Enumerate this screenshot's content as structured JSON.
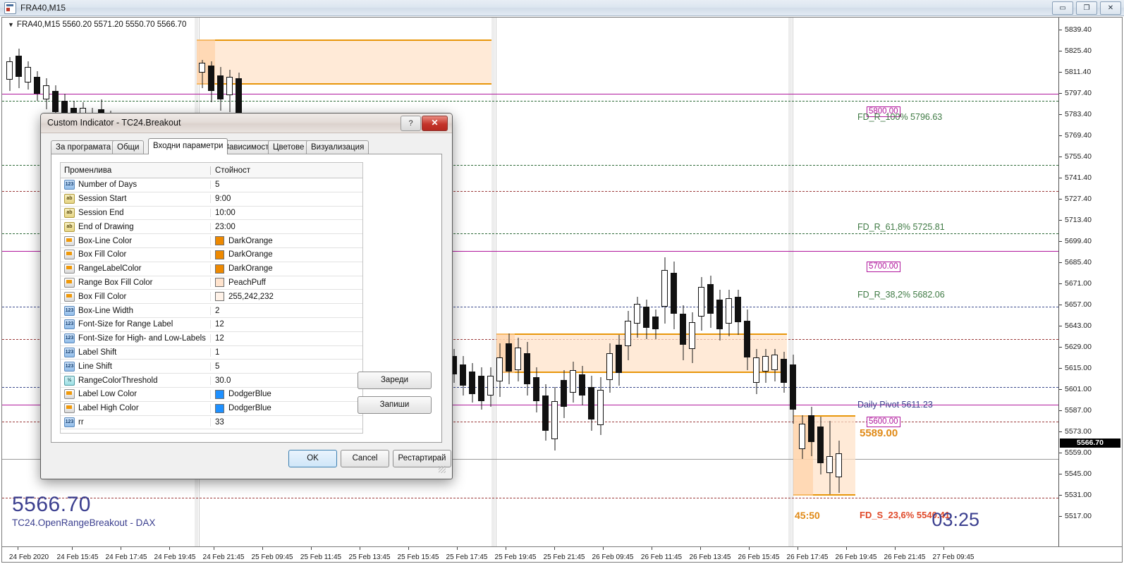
{
  "window": {
    "title": "FRA40,M15",
    "icon": "chart-window-icon",
    "buttons": {
      "minimize": "▭",
      "restore": "❐",
      "close": "✕"
    }
  },
  "chart": {
    "symbol_line": "FRA40,M15  5560.20 5571.20 5550.70 5566.70",
    "big_price": "5566.70",
    "sub_title": "TC24.OpenRangeBreakout - DAX",
    "clock": "03:25",
    "session_label": "45:50",
    "price_axis": {
      "ticks": [
        "5839.40",
        "5825.40",
        "5811.40",
        "5797.40",
        "5783.40",
        "5769.40",
        "5755.40",
        "5741.40",
        "5727.40",
        "5713.40",
        "5699.40",
        "5685.40",
        "5671.00",
        "5657.00",
        "5643.00",
        "5629.00",
        "5615.00",
        "5601.00",
        "5587.00",
        "5573.00",
        "5559.00",
        "5545.00",
        "5531.00",
        "5517.00"
      ],
      "last_price": "5566.70"
    },
    "time_axis": {
      "ticks": [
        "24 Feb 2020",
        "24 Feb 15:45",
        "24 Feb 17:45",
        "24 Feb 19:45",
        "24 Feb 21:45",
        "25 Feb 09:45",
        "25 Feb 11:45",
        "25 Feb 13:45",
        "25 Feb 15:45",
        "25 Feb 17:45",
        "25 Feb 19:45",
        "25 Feb 21:45",
        "26 Feb 09:45",
        "26 Feb 11:45",
        "26 Feb 13:45",
        "26 Feb 15:45",
        "26 Feb 17:45",
        "26 Feb 19:45",
        "26 Feb 21:45",
        "27 Feb 09:45"
      ]
    },
    "annotations": [
      {
        "text": "5800.00",
        "type": "tag"
      },
      {
        "text": "FD_R_100% 5796.63",
        "type": "green"
      },
      {
        "text": "FD_R_61,8% 5725.81",
        "type": "green"
      },
      {
        "text": "5700.00",
        "type": "tag"
      },
      {
        "text": "FD_R_38,2% 5682.06",
        "type": "green"
      },
      {
        "text": "Daily Pivot 5611.23",
        "type": "blue"
      },
      {
        "text": "5600.00",
        "type": "tag"
      },
      {
        "text": "5589.00",
        "type": "orange"
      },
      {
        "text": "FD_S_23,6% 5540.41",
        "type": "red"
      }
    ],
    "colors": {
      "pivot_line": "#b0179c",
      "fib_line": "#2f6b3a",
      "box_line": "#e8960a",
      "box_fill": "#ffe2c7",
      "label_blue": "#3b3f8f"
    }
  },
  "dialog": {
    "title": "Custom Indicator - TC24.Breakout",
    "help_label": "?",
    "close_label": "✕",
    "tabs": [
      {
        "label": "За програмата",
        "active": false
      },
      {
        "label": "Общи",
        "active": false
      },
      {
        "label": "Входни параметри",
        "active": true
      },
      {
        "label": "Зависимости",
        "active": false
      },
      {
        "label": "Цветове",
        "active": false
      },
      {
        "label": "Визуализация",
        "active": false
      }
    ],
    "grid": {
      "header": {
        "variable": "Променлива",
        "value": "Стойност"
      },
      "rows": [
        {
          "icon": "num",
          "name": "Number of Days",
          "value": "5"
        },
        {
          "icon": "str",
          "name": "Session Start",
          "value": "9:00"
        },
        {
          "icon": "str",
          "name": "Session End",
          "value": "10:00"
        },
        {
          "icon": "str",
          "name": "End of Drawing",
          "value": "23:00"
        },
        {
          "icon": "col",
          "name": "Box-Line Color",
          "value": "DarkOrange",
          "swatch": "#ee8900"
        },
        {
          "icon": "col",
          "name": "Box Fill Color",
          "value": "DarkOrange",
          "swatch": "#ee8900"
        },
        {
          "icon": "col",
          "name": "RangeLabelColor",
          "value": "DarkOrange",
          "swatch": "#ee8900"
        },
        {
          "icon": "col",
          "name": "Range Box Fill Color",
          "value": "PeachPuff",
          "swatch": "#ffe3cd"
        },
        {
          "icon": "col",
          "name": "Box Fill Color",
          "value": "255,242,232",
          "swatch": "#fff2e8"
        },
        {
          "icon": "num",
          "name": "Box-Line Width",
          "value": "2"
        },
        {
          "icon": "num",
          "name": "Font-Size for Range Label",
          "value": "12"
        },
        {
          "icon": "num",
          "name": "Font-Size for High- and Low-Labels",
          "value": "12"
        },
        {
          "icon": "num",
          "name": "Label Shift",
          "value": "1"
        },
        {
          "icon": "num",
          "name": "Line Shift",
          "value": "5"
        },
        {
          "icon": "dbl",
          "name": "RangeColorThreshold",
          "value": "30.0"
        },
        {
          "icon": "col",
          "name": "Label Low Color",
          "value": "DodgerBlue",
          "swatch": "#1e90ff"
        },
        {
          "icon": "col",
          "name": "Label High Color",
          "value": "DodgerBlue",
          "swatch": "#1e90ff"
        },
        {
          "icon": "num",
          "name": "rr",
          "value": "33"
        }
      ]
    },
    "side_buttons": {
      "load": "Зареди",
      "save": "Запиши"
    },
    "footer_buttons": {
      "ok": "OK",
      "cancel": "Cancel",
      "restart": "Рестартирай"
    }
  }
}
